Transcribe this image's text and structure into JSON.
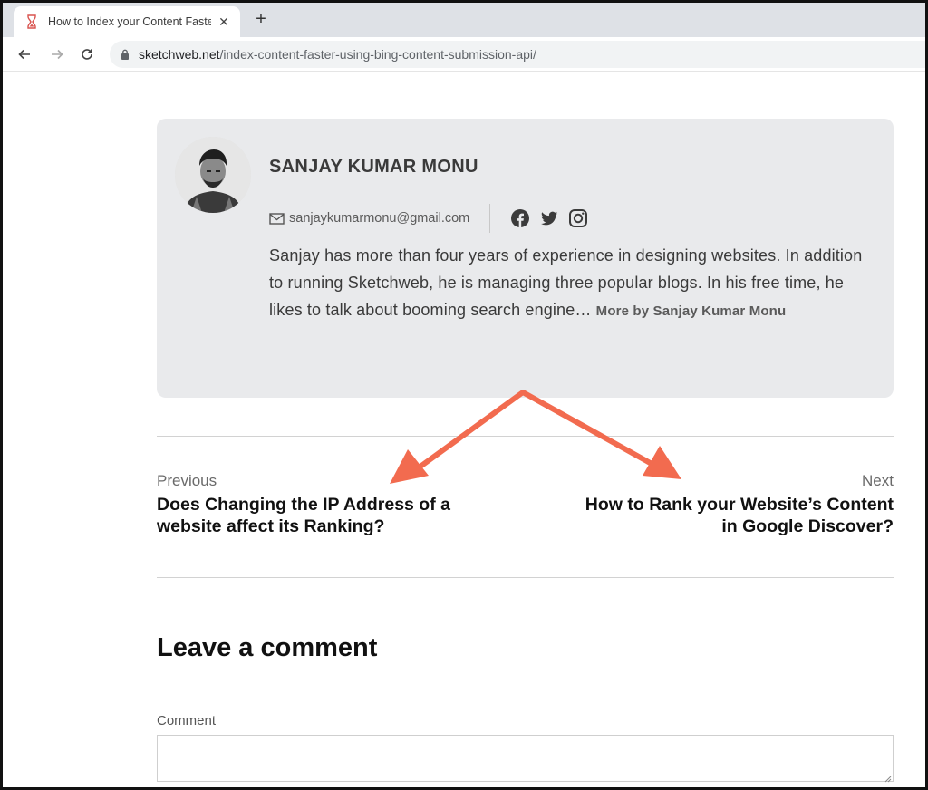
{
  "browser": {
    "tab_title": "How to Index your Content Faste",
    "new_tab_label": "+",
    "close_label": "✕",
    "url_domain": "sketchweb.net",
    "url_path": "/index-content-faster-using-bing-content-submission-api/"
  },
  "author": {
    "name": "SANJAY KUMAR MONU",
    "email": "sanjaykumarmonu@gmail.com",
    "social": [
      "facebook-icon",
      "twitter-icon",
      "instagram-icon"
    ],
    "bio": "Sanjay has more than four years of experience in designing websites. In addition to running Sketchweb, he is managing three popular blogs. In his free time, he likes to talk about booming search engine…",
    "more_link": "More by Sanjay Kumar Monu"
  },
  "post_nav": {
    "prev_label": "Previous",
    "prev_title": "Does Changing the IP Address of a website affect its Ranking?",
    "next_label": "Next",
    "next_title": "How to Rank your Website’s Content in Google Discover?"
  },
  "comments": {
    "heading": "Leave a comment",
    "field_label": "Comment",
    "field_value": ""
  },
  "colors": {
    "arrow": "#f26b4f",
    "author_box_bg": "#e9eaec"
  }
}
